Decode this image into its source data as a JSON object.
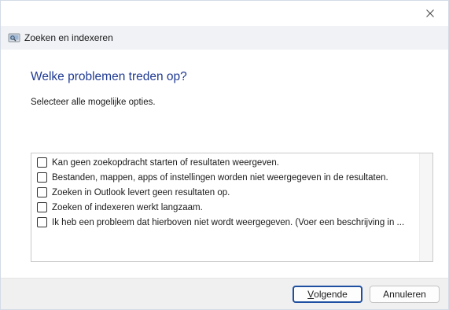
{
  "window": {
    "title": "Zoeken en indexeren",
    "close_icon": "close-icon",
    "app_icon": "search-indexing-icon"
  },
  "main": {
    "heading": "Welke problemen treden op?",
    "instruction": "Selecteer alle mogelijke opties.",
    "options": [
      {
        "label": "Kan geen zoekopdracht starten of resultaten weergeven.",
        "checked": false
      },
      {
        "label": "Bestanden, mappen, apps of instellingen worden niet weergegeven in de resultaten.",
        "checked": false
      },
      {
        "label": "Zoeken in Outlook levert geen resultaten op.",
        "checked": false
      },
      {
        "label": "Zoeken of indexeren werkt langzaam.",
        "checked": false
      },
      {
        "label": "Ik heb een probleem dat hierboven niet wordt weergegeven. (Voer een beschrijving in ...",
        "checked": false
      }
    ]
  },
  "footer": {
    "next_label_access_key": "V",
    "next_label_rest": "olgende",
    "cancel_label": "Annuleren"
  },
  "colors": {
    "heading": "#1f3a93",
    "header_strip": "#f0f2f5",
    "footer": "#f0f0f0",
    "default_button_border": "#1f4fa0"
  }
}
